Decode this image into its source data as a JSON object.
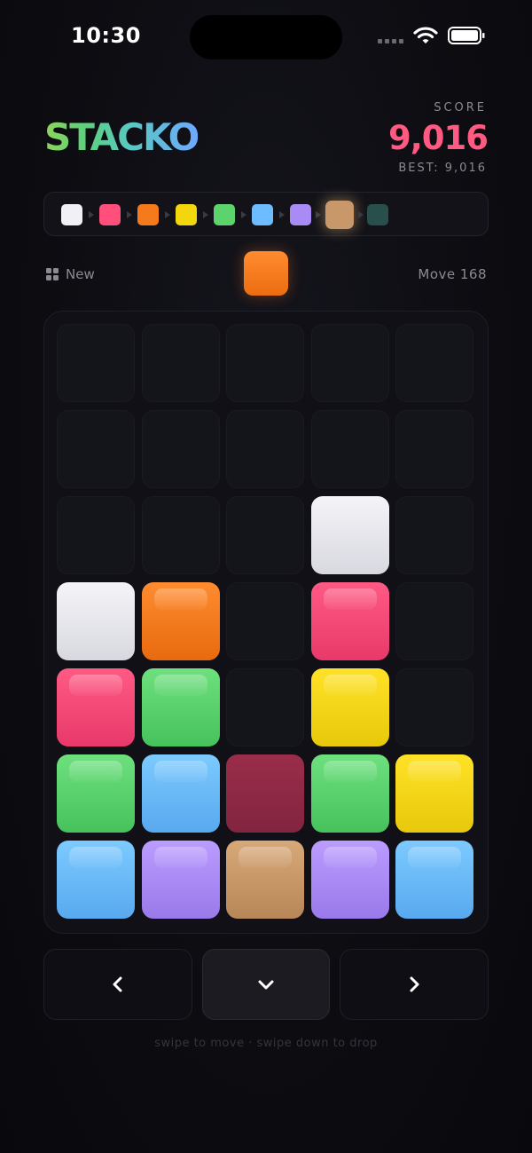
{
  "status": {
    "time": "10:30"
  },
  "header": {
    "logo": "STACKO",
    "score_label": "SCORE",
    "score": "9,016",
    "best": "BEST: 9,016"
  },
  "evolution": [
    {
      "name": "white",
      "color": "#f0f0f5"
    },
    {
      "name": "pink",
      "color": "#ff4f7a"
    },
    {
      "name": "orange",
      "color": "#f57a1c"
    },
    {
      "name": "yellow",
      "color": "#f3d60d"
    },
    {
      "name": "green",
      "color": "#5cd46e"
    },
    {
      "name": "blue",
      "color": "#6cbcff"
    },
    {
      "name": "purple",
      "color": "#a98bf5"
    },
    {
      "name": "tan",
      "color": "#c8986a",
      "current": true
    },
    {
      "name": "teal",
      "color": "#2e5a56"
    }
  ],
  "next": {
    "label": "New",
    "piece": "orange",
    "move_label": "Move 168"
  },
  "board": {
    "rows": 7,
    "cols": 5,
    "tiles": [
      [
        null,
        null,
        null,
        null,
        null
      ],
      [
        null,
        null,
        null,
        null,
        null
      ],
      [
        null,
        null,
        null,
        "white",
        null
      ],
      [
        "white",
        "orange",
        null,
        "pink",
        null
      ],
      [
        "pink",
        "green",
        null,
        "yellow",
        null
      ],
      [
        "green",
        "blue",
        "maroon",
        "green",
        "yellow"
      ],
      [
        "blue",
        "purple",
        "tan",
        "purple",
        "blue"
      ]
    ]
  },
  "colors": {
    "white": [
      "#f4f4f8",
      "#d8d8e0"
    ],
    "orange": [
      "#ff8c30",
      "#e86a0e"
    ],
    "pink": [
      "#ff5a84",
      "#e8396a"
    ],
    "green": [
      "#6ee07e",
      "#46c25c"
    ],
    "yellow": [
      "#ffe227",
      "#e8c80a"
    ],
    "blue": [
      "#7ccaff",
      "#58a9ef"
    ],
    "purple": [
      "#bb9cff",
      "#9a79ea"
    ],
    "tan": [
      "#d7a878",
      "#b88758"
    ],
    "maroon": [
      "#9a2d4a",
      "#822540"
    ]
  },
  "controls": {
    "left": "chevron-left-icon",
    "center": "chevron-down-icon",
    "right": "chevron-right-icon",
    "hint": "swipe to move · swipe down to drop"
  }
}
